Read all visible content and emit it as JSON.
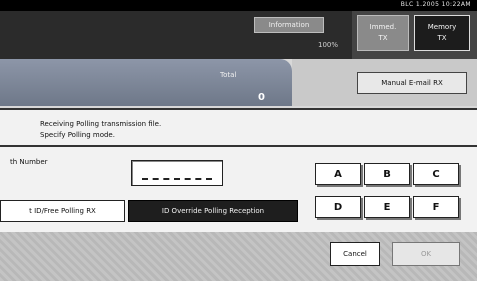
{
  "status": {
    "text": "BLC  1.2005 10:22AM"
  },
  "header": {
    "information_label": "Information",
    "memory_percent": "100%",
    "mode_immed": [
      "Immed.",
      "TX"
    ],
    "mode_memory": [
      "Memory",
      "TX"
    ]
  },
  "total": {
    "label": "Total",
    "value": "0"
  },
  "manual_email_label": "Manual E-mail RX",
  "dialog": {
    "message_line1": "Receiving Polling transmission file.",
    "message_line2": "Specify Polling mode.",
    "field_label": "th Number",
    "keys": [
      "A",
      "B",
      "C",
      "D",
      "E",
      "F"
    ],
    "poll_free_label": "t ID/Free Polling RX",
    "poll_override_label": "ID Override Polling Reception",
    "cancel_label": "Cancel",
    "ok_label": "OK"
  }
}
